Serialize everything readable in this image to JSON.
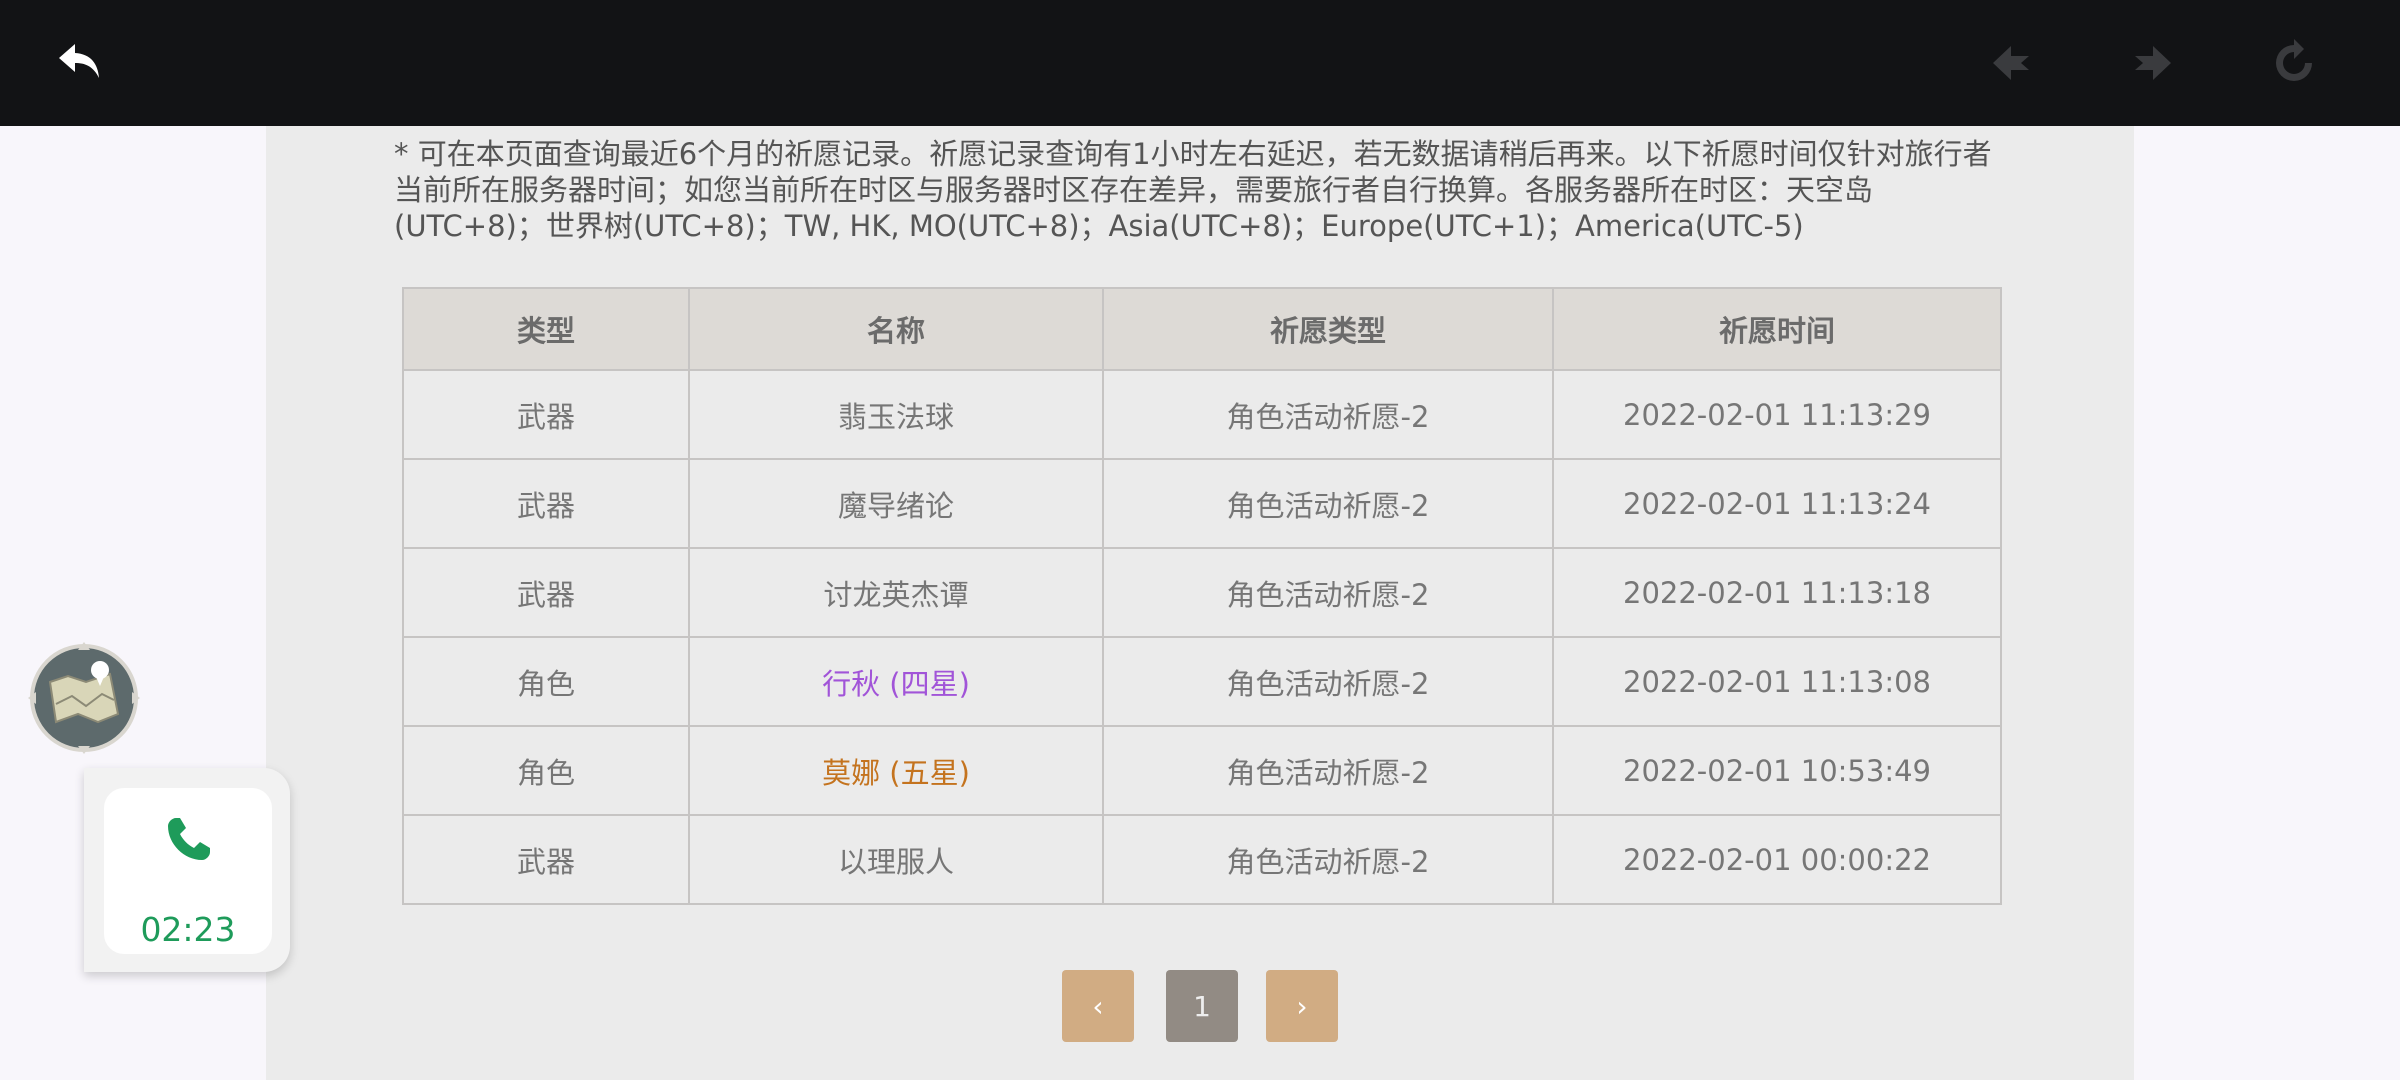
{
  "notice": "* 可在本页面查询最近6个月的祈愿记录。祈愿记录查询有1小时左右延迟，若无数据请稍后再来。以下祈愿时间仅针对旅行者当前所在服务器时间；如您当前所在时区与服务器时区存在差异，需要旅行者自行换算。各服务器所在时区：天空岛(UTC+8)；世界树(UTC+8)；TW, HK, MO(UTC+8)；Asia(UTC+8)；Europe(UTC+1)；America(UTC-5)",
  "table": {
    "headers": [
      "类型",
      "名称",
      "祈愿类型",
      "祈愿时间"
    ],
    "rows": [
      {
        "type": "武器",
        "name": "翡玉法球",
        "wish_type": "角色活动祈愿-2",
        "time": "2022-02-01 11:13:29",
        "color": "#767676"
      },
      {
        "type": "武器",
        "name": "魔导绪论",
        "wish_type": "角色活动祈愿-2",
        "time": "2022-02-01 11:13:24",
        "color": "#767676"
      },
      {
        "type": "武器",
        "name": "讨龙英杰谭",
        "wish_type": "角色活动祈愿-2",
        "time": "2022-02-01 11:13:18",
        "color": "#767676"
      },
      {
        "type": "角色",
        "name": "行秋 (四星)",
        "wish_type": "角色活动祈愿-2",
        "time": "2022-02-01 11:13:08",
        "color": "#a154d8"
      },
      {
        "type": "角色",
        "name": "莫娜 (五星)",
        "wish_type": "角色活动祈愿-2",
        "time": "2022-02-01 10:53:49",
        "color": "#c4731e"
      },
      {
        "type": "武器",
        "name": "以理服人",
        "wish_type": "角色活动祈愿-2",
        "time": "2022-02-01 00:00:22",
        "color": "#767676"
      }
    ]
  },
  "pagination": {
    "prev_label": "‹",
    "current_page": "1",
    "next_label": "›"
  },
  "call": {
    "duration": "02:23",
    "accent": "#1e9b5a"
  },
  "icons": {
    "back": "back-arrow-icon",
    "nav_prev": "nav-prev-icon",
    "nav_next": "nav-next-icon",
    "refresh": "refresh-icon",
    "map": "map-icon",
    "phone": "phone-icon"
  },
  "colors": {
    "topbar": "#121315",
    "page": "#ebebeb",
    "header_row": "#dddad6",
    "pager_active": "#d1ac83",
    "pager_current": "#928b84"
  }
}
